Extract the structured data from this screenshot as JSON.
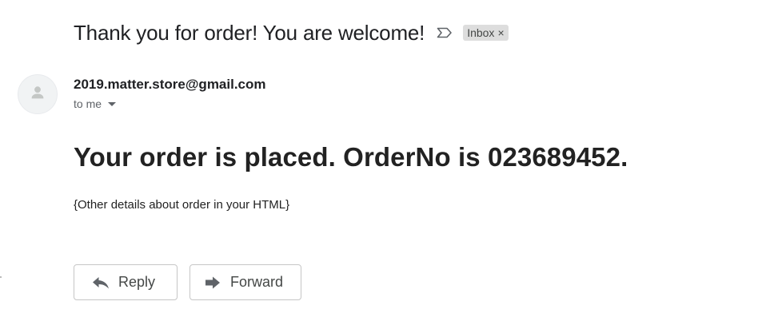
{
  "email": {
    "subject": "Thank you for order! You are welcome!",
    "label": "Inbox",
    "label_close": "×",
    "sender": "2019.matter.store@gmail.com",
    "recipient": "to me",
    "body_heading": "Your order is placed. OrderNo is 023689452.",
    "body_note": "{Other details about order in your HTML}"
  },
  "actions": {
    "reply_label": "Reply",
    "forward_label": "Forward"
  },
  "icons": {
    "important": "important-marker-icon",
    "avatar": "person-icon",
    "recipient_caret": "caret-down-icon",
    "reply": "reply-icon",
    "forward": "forward-icon",
    "label_close": "close-icon"
  },
  "colors": {
    "text_primary": "#202124",
    "text_secondary": "#5f6368",
    "chip_bg": "#dddddd",
    "button_border": "#c6c6c6",
    "icon_gray": "#5f6368"
  }
}
